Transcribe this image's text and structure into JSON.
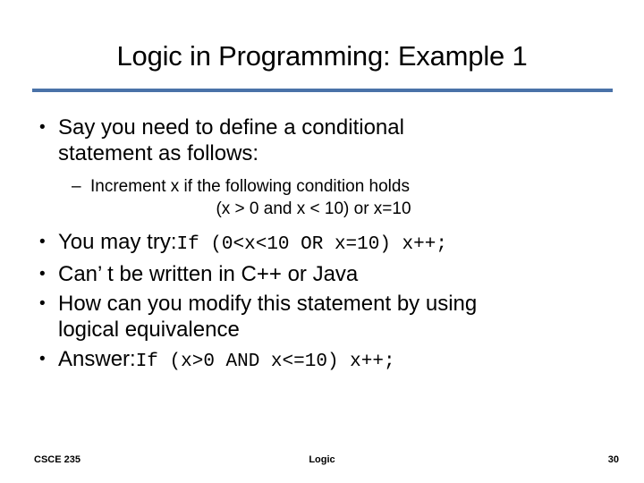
{
  "slide": {
    "title": "Logic in Programming: Example 1",
    "rule_color": "#4a72a8",
    "bullets": {
      "b1_line1": "Say you need to define a conditional",
      "b1_line2": "statement as follows:",
      "sub1": "Increment x if the following condition holds",
      "sub2": "(x > 0 and x < 10) or x=10",
      "b2_label": "You may try:",
      "b2_code": "If (0<x<10 OR x=10) x++;",
      "b3": "Can’ t be written in C++ or Java",
      "b4_line1": "How can you modify this statement by using",
      "b4_line2": "logical equivalence",
      "b5_label": "Answer:",
      "b5_code": "If (x>0 AND x<=10) x++;"
    },
    "markers": {
      "level1": "•",
      "level2": "–"
    },
    "footer": {
      "left": "CSCE 235",
      "center": "Logic",
      "right": "30"
    }
  }
}
